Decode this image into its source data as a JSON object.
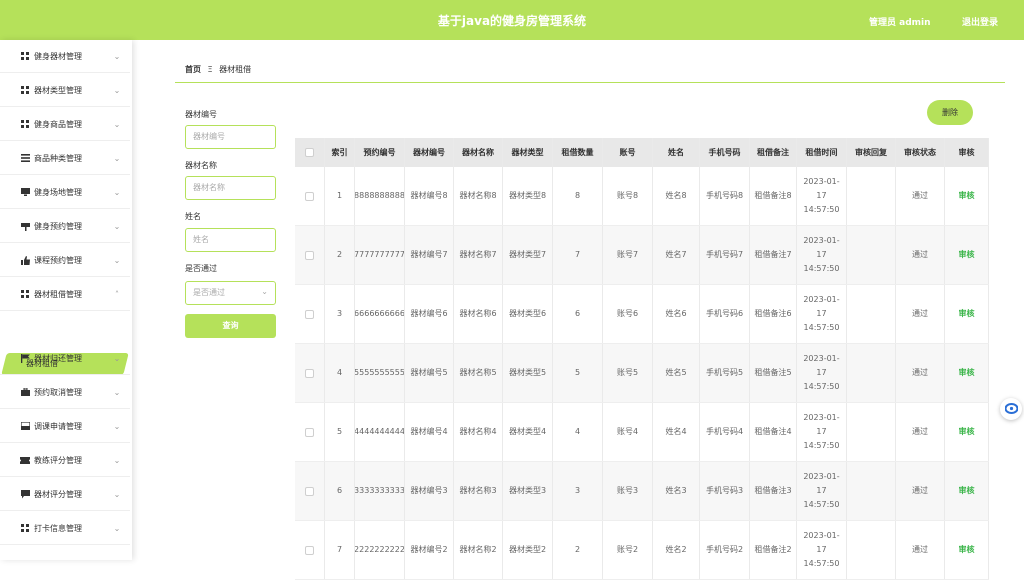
{
  "header": {
    "title": "基于java的健身房管理系统",
    "user": "管理员 admin",
    "logout": "退出登录"
  },
  "sidebar": {
    "items": [
      {
        "label": "健身器材管理",
        "icon": "grid-icon"
      },
      {
        "label": "器材类型管理",
        "icon": "grid-icon"
      },
      {
        "label": "健身商品管理",
        "icon": "grid-icon"
      },
      {
        "label": "商品种类管理",
        "icon": "list-icon"
      },
      {
        "label": "健身场地管理",
        "icon": "monitor-icon"
      },
      {
        "label": "健身预约管理",
        "icon": "signpost-icon"
      },
      {
        "label": "课程预约管理",
        "icon": "thumbs-up-icon"
      },
      {
        "label": "器材租借管理",
        "icon": "grid-icon"
      },
      {
        "label": "器材归还管理",
        "icon": "flag-icon"
      },
      {
        "label": "预约取消管理",
        "icon": "briefcase-icon"
      },
      {
        "label": "调课申请管理",
        "icon": "inbox-icon"
      },
      {
        "label": "教练评分管理",
        "icon": "ticket-icon"
      },
      {
        "label": "器材评分管理",
        "icon": "chat-icon"
      },
      {
        "label": "打卡信息管理",
        "icon": "grid-icon"
      }
    ],
    "active_sub": "器材租借"
  },
  "breadcrumb": {
    "home": "首页",
    "sep": "Ξ",
    "current": "器材租借"
  },
  "search": {
    "equip_code_label": "器材编号",
    "equip_code_placeholder": "器材编号",
    "equip_name_label": "器材名称",
    "equip_name_placeholder": "器材名称",
    "name_label": "姓名",
    "name_placeholder": "姓名",
    "approved_label": "是否通过",
    "approved_placeholder": "是否通过",
    "query": "查询"
  },
  "actions": {
    "delete": "删除"
  },
  "table": {
    "headers": [
      "索引",
      "预约编号",
      "器材编号",
      "器材名称",
      "器材类型",
      "租借数量",
      "账号",
      "姓名",
      "手机号码",
      "租借备注",
      "租借时间",
      "审核回复",
      "审核状态",
      "审核"
    ],
    "rows": [
      [
        "1",
        "8888888888",
        "器材编号8",
        "器材名称8",
        "器材类型8",
        "8",
        "账号8",
        "姓名8",
        "手机号码8",
        "租借备注8",
        "2023-01-17 14:57:50",
        "",
        "通过",
        "审核"
      ],
      [
        "2",
        "7777777777",
        "器材编号7",
        "器材名称7",
        "器材类型7",
        "7",
        "账号7",
        "姓名7",
        "手机号码7",
        "租借备注7",
        "2023-01-17 14:57:50",
        "",
        "通过",
        "审核"
      ],
      [
        "3",
        "6666666666",
        "器材编号6",
        "器材名称6",
        "器材类型6",
        "6",
        "账号6",
        "姓名6",
        "手机号码6",
        "租借备注6",
        "2023-01-17 14:57:50",
        "",
        "通过",
        "审核"
      ],
      [
        "4",
        "5555555555",
        "器材编号5",
        "器材名称5",
        "器材类型5",
        "5",
        "账号5",
        "姓名5",
        "手机号码5",
        "租借备注5",
        "2023-01-17 14:57:50",
        "",
        "通过",
        "审核"
      ],
      [
        "5",
        "4444444444",
        "器材编号4",
        "器材名称4",
        "器材类型4",
        "4",
        "账号4",
        "姓名4",
        "手机号码4",
        "租借备注4",
        "2023-01-17 14:57:50",
        "",
        "通过",
        "审核"
      ],
      [
        "6",
        "3333333333",
        "器材编号3",
        "器材名称3",
        "器材类型3",
        "3",
        "账号3",
        "姓名3",
        "手机号码3",
        "租借备注3",
        "2023-01-17 14:57:50",
        "",
        "通过",
        "审核"
      ],
      [
        "7",
        "2222222222",
        "器材编号2",
        "器材名称2",
        "器材类型2",
        "2",
        "账号2",
        "姓名2",
        "手机号码2",
        "租借备注2",
        "2023-01-17 14:57:50",
        "",
        "通过",
        "审核"
      ]
    ]
  },
  "colors": {
    "accent": "#b5e15a",
    "audit_link": "#3bb54a"
  }
}
